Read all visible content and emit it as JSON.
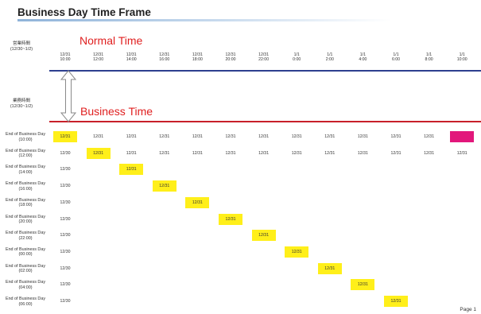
{
  "title": "Business Day Time Frame",
  "labels": {
    "normal_time": "Normal Time",
    "business_time": "Business Time"
  },
  "side_headers": {
    "normal": {
      "line1": "営業時間",
      "line2": "(12/30~1/2)"
    },
    "business": {
      "line1": "業務時間",
      "line2": "(12/30~1/2)"
    }
  },
  "columns": [
    {
      "date": "12/31",
      "time": "10:00"
    },
    {
      "date": "12/31",
      "time": "12:00"
    },
    {
      "date": "12/31",
      "time": "14:00"
    },
    {
      "date": "12/31",
      "time": "16:00"
    },
    {
      "date": "12/31",
      "time": "18:00"
    },
    {
      "date": "12/31",
      "time": "20:00"
    },
    {
      "date": "12/31",
      "time": "22:00"
    },
    {
      "date": "1/1",
      "time": "0:00"
    },
    {
      "date": "1/1",
      "time": "2:00"
    },
    {
      "date": "1/1",
      "time": "4:00"
    },
    {
      "date": "1/1",
      "time": "6:00"
    },
    {
      "date": "1/1",
      "time": "8:00"
    },
    {
      "date": "1/1",
      "time": "10:00"
    }
  ],
  "rows": [
    {
      "label": "End of Business Day",
      "time": "(10:00)",
      "first_cell": "12/31",
      "highlight": 0,
      "rest": "12/31",
      "end_marker": "magenta"
    },
    {
      "label": "End of Business Day",
      "time": "(12:00)",
      "first_cell": "12/30",
      "highlight": 1,
      "rest": "12/31",
      "end_marker": "12/31"
    },
    {
      "label": "End of Business Day",
      "time": "(14:00)",
      "first_cell": "12/30",
      "highlight": 2
    },
    {
      "label": "End of Business Day",
      "time": "(16:00)",
      "first_cell": "12/30",
      "highlight": 3
    },
    {
      "label": "End of Business Day",
      "time": "(18:00)",
      "first_cell": "12/30",
      "highlight": 4
    },
    {
      "label": "End of Business Day",
      "time": "(20:00)",
      "first_cell": "12/30",
      "highlight": 5
    },
    {
      "label": "End of Business Day",
      "time": "(22:00)",
      "first_cell": "12/30",
      "highlight": 6
    },
    {
      "label": "End of Business Day",
      "time": "(00:00)",
      "first_cell": "12/30",
      "highlight": 7
    },
    {
      "label": "End of Business Day",
      "time": "(02:00)",
      "first_cell": "12/30",
      "highlight": 8
    },
    {
      "label": "End of Business Day",
      "time": "(04:00)",
      "first_cell": "12/30",
      "highlight": 9
    },
    {
      "label": "End of Business Day",
      "time": "(06:00)",
      "first_cell": "12/30",
      "highlight": 10
    }
  ],
  "highlight_text": "12/31",
  "colors": {
    "highlight": "#ffef1a",
    "marker": "#e2177b",
    "normal_line": "#2d3f8f",
    "business_line": "#c8202a"
  },
  "footer": {
    "page": "Page 1"
  }
}
